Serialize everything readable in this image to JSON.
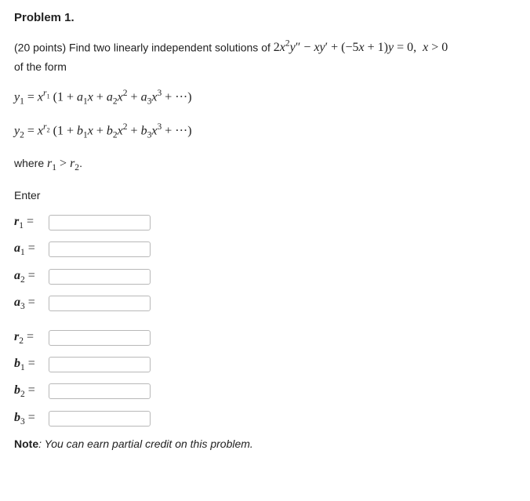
{
  "title": "Problem 1.",
  "intro_points": "(20 points)",
  "intro_a": " Find two linearly independent solutions of ",
  "equation_main": "2x²y″ − xy′ + (−5x + 1)y = 0,  x > 0",
  "intro_b": "of the form",
  "y1_line": "y₁ = xʳ¹ (1 + a₁x + a₂x² + a₃x³ + ⋯)",
  "y2_line": "y₂ = xʳ² (1 + b₁x + b₂x² + b₃x³ + ⋯)",
  "where_line": "where r₁ > r₂.",
  "enter": "Enter",
  "labels": {
    "r1": "r₁ =",
    "a1": "a₁ =",
    "a2": "a₂ =",
    "a3": "a₃ =",
    "r2": "r₂ =",
    "b1": "b₁ =",
    "b2": "b₂ =",
    "b3": "b₃ ="
  },
  "note_bold": "Note",
  "note_text": ": You can earn partial credit on this problem."
}
